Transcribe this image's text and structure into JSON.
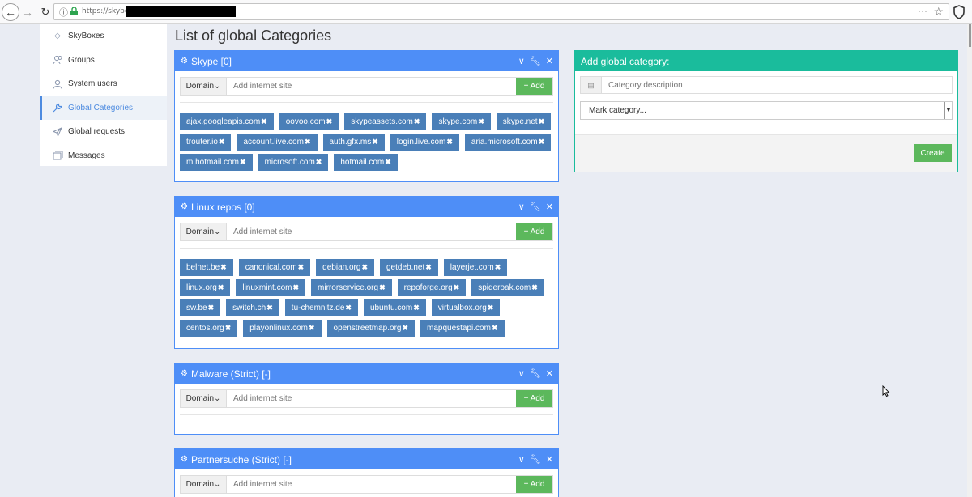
{
  "browser": {
    "url": "https://skybo"
  },
  "sidebar": {
    "items": [
      {
        "label": "SkyBoxes",
        "icon": "diamond-icon"
      },
      {
        "label": "Groups",
        "icon": "users-icon"
      },
      {
        "label": "System users",
        "icon": "user-icon"
      },
      {
        "label": "Global Categories",
        "icon": "wrench-icon",
        "active": true
      },
      {
        "label": "Global requests",
        "icon": "send-icon"
      },
      {
        "label": "Messages",
        "icon": "messages-icon"
      }
    ]
  },
  "page": {
    "title": "List of global Categories"
  },
  "common": {
    "domain_label": "Domain",
    "site_placeholder": "Add internet site",
    "add_label": "+ Add"
  },
  "panels": [
    {
      "title": "Skype [0]",
      "tags": [
        "ajax.googleapis.com",
        "oovoo.com",
        "skypeassets.com",
        "skype.com",
        "skype.net",
        "trouter.io",
        "account.live.com",
        "auth.gfx.ms",
        "login.live.com",
        "aria.microsoft.com",
        "m.hotmail.com",
        "microsoft.com",
        "hotmail.com"
      ]
    },
    {
      "title": "Linux repos [0]",
      "tags": [
        "belnet.be",
        "canonical.com",
        "debian.org",
        "getdeb.net",
        "layerjet.com",
        "linux.org",
        "linuxmint.com",
        "mirrorservice.org",
        "repoforge.org",
        "spideroak.com",
        "sw.be",
        "switch.ch",
        "tu-chemnitz.de",
        "ubuntu.com",
        "virtualbox.org",
        "centos.org",
        "playonlinux.com",
        "openstreetmap.org",
        "mapquestapi.com"
      ]
    },
    {
      "title": "Malware (Strict) [-]",
      "tags": []
    },
    {
      "title": "Partnersuche (Strict) [-]",
      "tags": []
    }
  ],
  "add_category": {
    "title": "Add global category:",
    "description_placeholder": "Category description",
    "mark_select": "Mark category...",
    "create_label": "Create"
  },
  "colors": {
    "panel_blue": "#4e8ef7",
    "teal": "#1abc9c",
    "tag_blue": "#4a7fb8",
    "green": "#5cb85c"
  }
}
